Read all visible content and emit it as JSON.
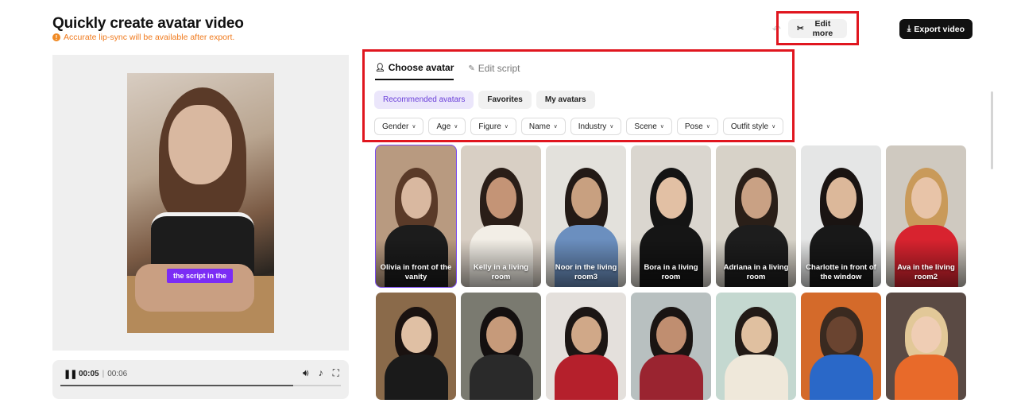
{
  "header": {
    "title": "Quickly create avatar video",
    "notice": "Accurate lip-sync will be available after export.",
    "edit_more_label": "Edit more",
    "export_label": "Export video"
  },
  "preview": {
    "caption": "the script in the"
  },
  "player": {
    "current_time": "00:05",
    "total_time": "00:06",
    "progress": 0.83
  },
  "tabs": [
    {
      "label": "Choose avatar",
      "active": true
    },
    {
      "label": "Edit script",
      "active": false
    }
  ],
  "subtabs": [
    {
      "label": "Recommended avatars",
      "active": true
    },
    {
      "label": "Favorites",
      "active": false
    },
    {
      "label": "My avatars",
      "active": false
    }
  ],
  "filters": [
    "Gender",
    "Age",
    "Figure",
    "Name",
    "Industry",
    "Scene",
    "Pose",
    "Outfit style"
  ],
  "avatars": [
    {
      "label": "Olivia in front of the vanity",
      "bg": "#b89a80",
      "hair": "#5a3a28",
      "skin": "#d9b8a0",
      "top": "#1c1c1c",
      "selected": true
    },
    {
      "label": "Kelly in a living room",
      "bg": "#d8cfc4",
      "hair": "#2a1e18",
      "skin": "#c49476",
      "top": "#f2eee6",
      "selected": false
    },
    {
      "label": "Noor in the living room3",
      "bg": "#e3e1dc",
      "hair": "#231a16",
      "skin": "#c8a080",
      "top": "#6b8fbf",
      "selected": false
    },
    {
      "label": "Bora in a living room",
      "bg": "#dad6cf",
      "hair": "#141414",
      "skin": "#e2c0a4",
      "top": "#151515",
      "selected": false
    },
    {
      "label": "Adriana in a living room",
      "bg": "#d7d2c8",
      "hair": "#2a1f18",
      "skin": "#c9a184",
      "top": "#1d1d1d",
      "selected": false
    },
    {
      "label": "Charlotte in front of the window",
      "bg": "#e5e6e6",
      "hair": "#1a1412",
      "skin": "#dcb89a",
      "top": "#181818",
      "selected": false
    },
    {
      "label": "Ava in the living room2",
      "bg": "#cfc9c0",
      "hair": "#c99a5a",
      "skin": "#e8c4a8",
      "top": "#d8232f",
      "selected": false
    },
    {
      "label": "",
      "bg": "#8a6a4a",
      "hair": "#1a1210",
      "skin": "#e0c0a4",
      "top": "#1a1a1a",
      "selected": false
    },
    {
      "label": "",
      "bg": "#7a7a70",
      "hair": "#141010",
      "skin": "#c69a7a",
      "top": "#2a2a2a",
      "selected": false
    },
    {
      "label": "",
      "bg": "#e4e0dc",
      "hair": "#1c1614",
      "skin": "#d0a888",
      "top": "#b5202c",
      "selected": false
    },
    {
      "label": "",
      "bg": "#b8c0c0",
      "hair": "#1a1412",
      "skin": "#c08e70",
      "top": "#9a2430",
      "selected": false
    },
    {
      "label": "",
      "bg": "#c4d8d0",
      "hair": "#221a16",
      "skin": "#e0c0a0",
      "top": "#efe8da",
      "selected": false
    },
    {
      "label": "",
      "bg": "#d46a2a",
      "hair": "#3a2a20",
      "skin": "#6a4430",
      "top": "#2a68c8",
      "selected": false
    },
    {
      "label": "",
      "bg": "#5a4a44",
      "hair": "#e2c898",
      "skin": "#efcdb4",
      "top": "#e86a2a",
      "selected": false
    }
  ]
}
